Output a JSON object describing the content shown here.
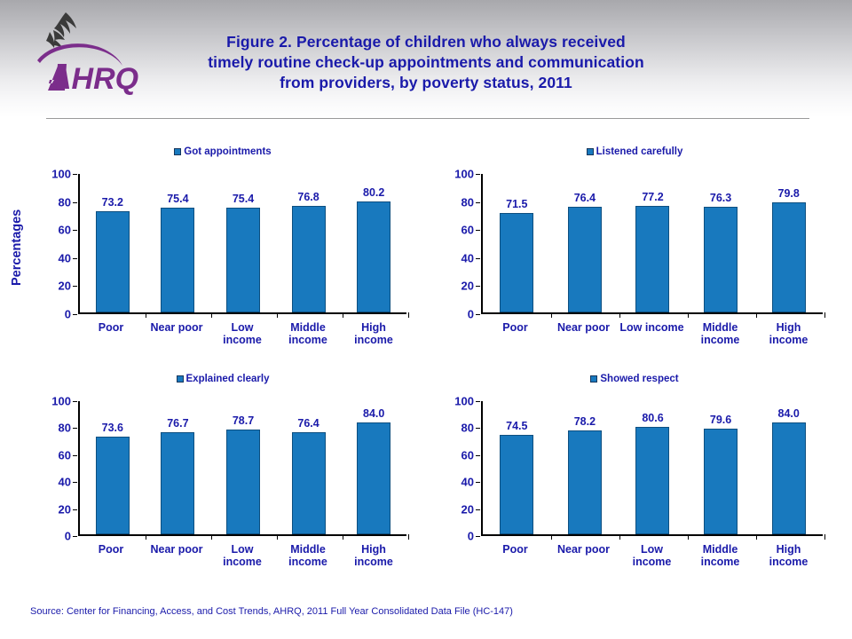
{
  "header": {
    "logo_alt": "AHRQ Agency for Healthcare Research and Quality",
    "title_line1": "Figure 2. Percentage of children who always received",
    "title_line2": "timely routine check-up appointments and communication",
    "title_line3": "from providers, by poverty status, 2011"
  },
  "axis": {
    "y_title": "Percentages"
  },
  "footer": {
    "source": "Source: Center for Financing, Access, and Cost Trends, AHRQ, 2011 Full Year Consolidated Data File (HC-147)"
  },
  "colors": {
    "bar_fill": "#1879be",
    "bar_border": "#0d4f80",
    "text_blue": "#1a1aaa",
    "logo_purple": "#7b2d8b",
    "header_gray": "#a8a8ac"
  },
  "chart_data": [
    {
      "type": "bar",
      "title": "Got appointments",
      "categories": [
        "Poor",
        "Near poor",
        "Low income",
        "Middle income",
        "High income"
      ],
      "category_lines": [
        [
          "Poor"
        ],
        [
          "Near poor"
        ],
        [
          "Low",
          "income"
        ],
        [
          "Middle",
          "income"
        ],
        [
          "High",
          "income"
        ]
      ],
      "values": [
        73.2,
        75.4,
        75.4,
        76.8,
        80.2
      ],
      "value_labels": [
        "73.2",
        "75.4",
        "75.4",
        "76.8",
        "80.2"
      ],
      "ylabel": "Percentages",
      "xlabel": "",
      "ylim": [
        0,
        100
      ],
      "yticks": [
        0,
        20,
        40,
        60,
        80,
        100
      ],
      "ytick_labels": [
        "0",
        "20",
        "40",
        "60",
        "80",
        "100"
      ],
      "grid": false,
      "legend_position": "top-center"
    },
    {
      "type": "bar",
      "title": "Listened carefully",
      "categories": [
        "Poor",
        "Near poor",
        "Low income",
        "Middle income",
        "High income"
      ],
      "category_lines": [
        [
          "Poor"
        ],
        [
          "Near poor"
        ],
        [
          "Low income"
        ],
        [
          "Middle",
          "income"
        ],
        [
          "High",
          "income"
        ]
      ],
      "values": [
        71.5,
        76.4,
        77.2,
        76.3,
        79.8
      ],
      "value_labels": [
        "71.5",
        "76.4",
        "77.2",
        "76.3",
        "79.8"
      ],
      "ylabel": "Percentages",
      "xlabel": "",
      "ylim": [
        0,
        100
      ],
      "yticks": [
        0,
        20,
        40,
        60,
        80,
        100
      ],
      "ytick_labels": [
        "0",
        "20",
        "40",
        "60",
        "80",
        "100"
      ],
      "grid": false,
      "legend_position": "top-center"
    },
    {
      "type": "bar",
      "title": "Explained clearly",
      "categories": [
        "Poor",
        "Near poor",
        "Low income",
        "Middle income",
        "High income"
      ],
      "category_lines": [
        [
          "Poor"
        ],
        [
          "Near poor"
        ],
        [
          "Low",
          "income"
        ],
        [
          "Middle",
          "income"
        ],
        [
          "High",
          "income"
        ]
      ],
      "values": [
        73.6,
        76.7,
        78.7,
        76.4,
        84.0
      ],
      "value_labels": [
        "73.6",
        "76.7",
        "78.7",
        "76.4",
        "84.0"
      ],
      "ylabel": "Percentages",
      "xlabel": "",
      "ylim": [
        0,
        100
      ],
      "yticks": [
        0,
        20,
        40,
        60,
        80,
        100
      ],
      "ytick_labels": [
        "0",
        "20",
        "40",
        "60",
        "80",
        "100"
      ],
      "grid": false,
      "legend_position": "top-center"
    },
    {
      "type": "bar",
      "title": "Showed respect",
      "categories": [
        "Poor",
        "Near poor",
        "Low income",
        "Middle income",
        "High income"
      ],
      "category_lines": [
        [
          "Poor"
        ],
        [
          "Near poor"
        ],
        [
          "Low",
          "income"
        ],
        [
          "Middle",
          "income"
        ],
        [
          "High",
          "income"
        ]
      ],
      "values": [
        74.5,
        78.2,
        80.6,
        79.6,
        84.0
      ],
      "value_labels": [
        "74.5",
        "78.2",
        "80.6",
        "79.6",
        "84.0"
      ],
      "ylabel": "Percentages",
      "xlabel": "",
      "ylim": [
        0,
        100
      ],
      "yticks": [
        0,
        20,
        40,
        60,
        80,
        100
      ],
      "ytick_labels": [
        "0",
        "20",
        "40",
        "60",
        "80",
        "100"
      ],
      "grid": false,
      "legend_position": "top-center"
    }
  ]
}
